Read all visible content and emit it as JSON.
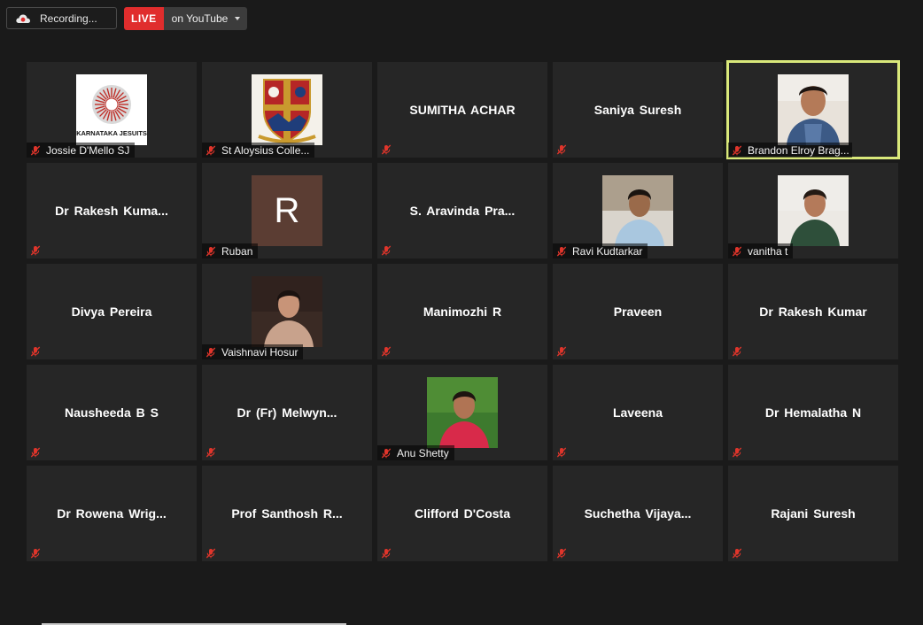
{
  "topbar": {
    "recording_label": "Recording...",
    "live_label": "LIVE",
    "live_target": "on YouTube",
    "recording_icon": "cloud-record-icon",
    "dropdown_icon": "caret-down-icon"
  },
  "colors": {
    "background": "#1a1a1a",
    "tile": "#262626",
    "active_speaker": "#d9e87a",
    "live": "#e02d2d",
    "muted_icon": "#e0352b"
  },
  "participants": [
    {
      "name": "Jossie D'Mello SJ",
      "display": "label",
      "thumb": "karnataka-jesuits-logo",
      "logo_text": "KARNATAKA JESUITS"
    },
    {
      "name": "St Aloysius Colle...",
      "display": "label",
      "thumb": "st-aloysius-crest"
    },
    {
      "name": "SUMITHA ACHAR",
      "display": "center"
    },
    {
      "name": "Saniya Suresh",
      "display": "center"
    },
    {
      "name": "Brandon Elroy Brag...",
      "display": "label",
      "thumb": "video-feed",
      "active": true
    },
    {
      "name": "Dr Rakesh Kuma...",
      "display": "center"
    },
    {
      "name": "Ruban",
      "display": "label",
      "thumb": "initial-avatar",
      "initial": "R"
    },
    {
      "name": "S. Aravinda Pra...",
      "display": "center"
    },
    {
      "name": "Ravi Kudtarkar",
      "display": "label",
      "thumb": "profile-photo"
    },
    {
      "name": "vanitha t",
      "display": "label",
      "thumb": "profile-photo"
    },
    {
      "name": "Divya Pereira",
      "display": "center"
    },
    {
      "name": "Vaishnavi Hosur",
      "display": "label",
      "thumb": "profile-photo"
    },
    {
      "name": "Manimozhi R",
      "display": "center"
    },
    {
      "name": "Praveen",
      "display": "center"
    },
    {
      "name": "Dr Rakesh Kumar",
      "display": "center"
    },
    {
      "name": "Nausheeda B S",
      "display": "center"
    },
    {
      "name": "Dr (Fr) Melwyn...",
      "display": "center"
    },
    {
      "name": "Anu Shetty",
      "display": "label",
      "thumb": "profile-photo"
    },
    {
      "name": "Laveena",
      "display": "center"
    },
    {
      "name": "Dr Hemalatha N",
      "display": "center"
    },
    {
      "name": "Dr Rowena Wrig...",
      "display": "center"
    },
    {
      "name": "Prof Santhosh R...",
      "display": "center"
    },
    {
      "name": "Clifford D'Costa",
      "display": "center"
    },
    {
      "name": "Suchetha Vijaya...",
      "display": "center"
    },
    {
      "name": "Rajani Suresh",
      "display": "center"
    }
  ]
}
